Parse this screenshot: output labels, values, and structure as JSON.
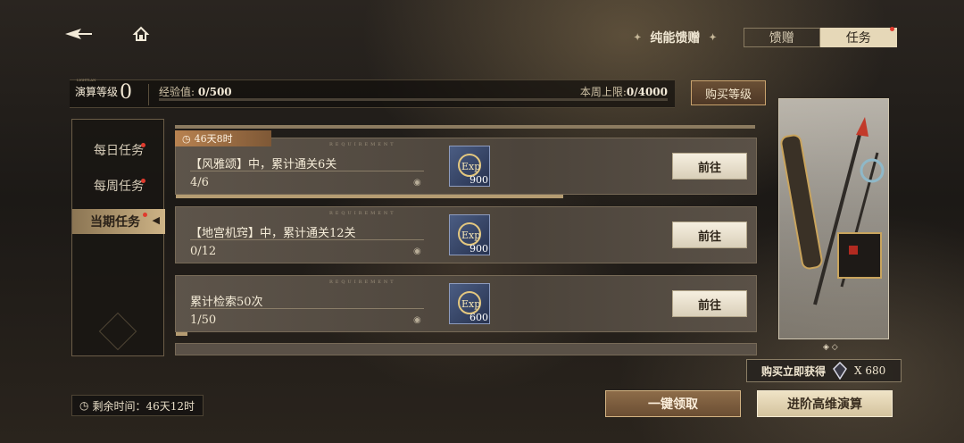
{
  "header": {
    "top_tabs": {
      "grant_label": "纯能馈赠",
      "tab1": "馈赠",
      "tab2": "任务",
      "active": "任务"
    }
  },
  "level": {
    "label": "演算等级",
    "label_small": "ᴸᴵᴳᴴᵀᴸᴬᴺ",
    "value": "0",
    "exp_label": "经验值:",
    "exp_value": "0/500",
    "weekly_label": "本周上限:",
    "weekly_value": "0/4000",
    "buy_button": "购买等级"
  },
  "sidebar": {
    "items": [
      {
        "label": "每日任务",
        "badge": true
      },
      {
        "label": "每周任务",
        "badge": true
      },
      {
        "label": "当期任务",
        "badge": true,
        "active": true
      }
    ]
  },
  "tasks": {
    "timer": "46天8时",
    "requirement_text": "REQUIREMENT",
    "items": [
      {
        "desc": "【风雅颂】中，累计通关6关",
        "progress": "4/6",
        "progress_fraction": 0.667,
        "reward_qty": "900",
        "go": "前往"
      },
      {
        "desc": "【地宫机窍】中，累计通关12关",
        "progress": "0/12",
        "progress_fraction": 0,
        "reward_qty": "900",
        "go": "前往"
      },
      {
        "desc": "累计检索50次",
        "progress": "1/50",
        "progress_fraction": 0.02,
        "reward_qty": "600",
        "go": "前往"
      }
    ]
  },
  "showcase": {
    "buy_label": "购买立即获得",
    "count": "X 680"
  },
  "footer": {
    "remaining": "剩余时间：46天12时",
    "claim_all": "一键领取",
    "advance": "进阶高维演算"
  },
  "colors": {
    "accent_gold": "#cdb386",
    "badge_red": "#e03b2e",
    "reward_blue": "#4b5d83"
  }
}
